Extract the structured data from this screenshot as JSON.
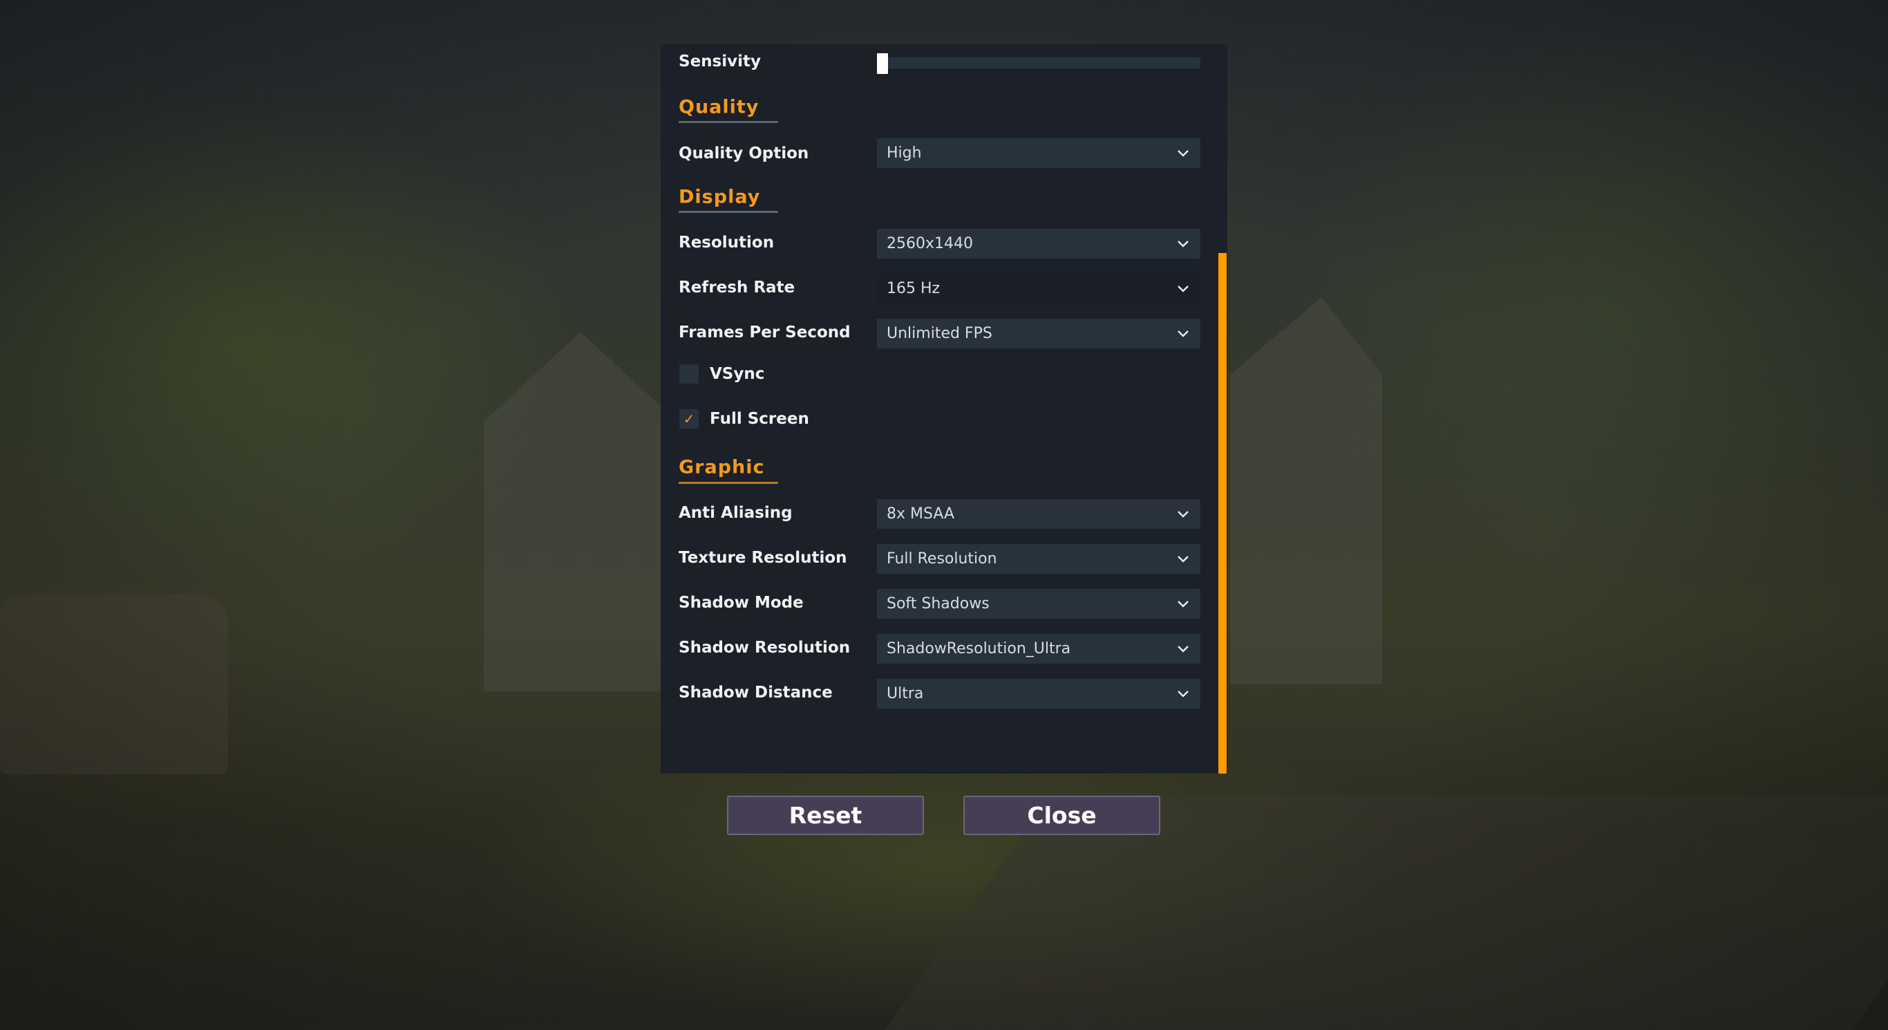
{
  "settings": {
    "sensitivity": {
      "label": "Sensivity",
      "value_fraction": 0.0
    },
    "sections": {
      "quality": {
        "title": "Quality"
      },
      "display": {
        "title": "Display"
      },
      "graphic": {
        "title": "Graphic"
      }
    },
    "quality_option": {
      "label": "Quality Option",
      "value": "High"
    },
    "resolution": {
      "label": "Resolution",
      "value": "2560x1440"
    },
    "refresh_rate": {
      "label": "Refresh Rate",
      "value": "165 Hz"
    },
    "fps": {
      "label": "Frames Per Second",
      "value": "Unlimited FPS"
    },
    "vsync": {
      "label": "VSync",
      "checked": false,
      "check_glyph": ""
    },
    "fullscreen": {
      "label": "Full Screen",
      "checked": true,
      "check_glyph": "✓"
    },
    "anti_aliasing": {
      "label": "Anti Aliasing",
      "value": "8x MSAA"
    },
    "texture_resolution": {
      "label": "Texture Resolution",
      "value": "Full Resolution"
    },
    "shadow_mode": {
      "label": "Shadow Mode",
      "value": "Soft Shadows"
    },
    "shadow_resolution": {
      "label": "Shadow Resolution",
      "value": "ShadowResolution_Ultra"
    },
    "shadow_distance": {
      "label": "Shadow Distance",
      "value": "Ultra"
    }
  },
  "buttons": {
    "reset": "Reset",
    "close": "Close"
  },
  "colors": {
    "accent": "#ff9d00",
    "section_title": "#f39a1e",
    "panel_bg": "#1b2029",
    "field_bg": "#27323c",
    "button_bg": "#463e57"
  }
}
